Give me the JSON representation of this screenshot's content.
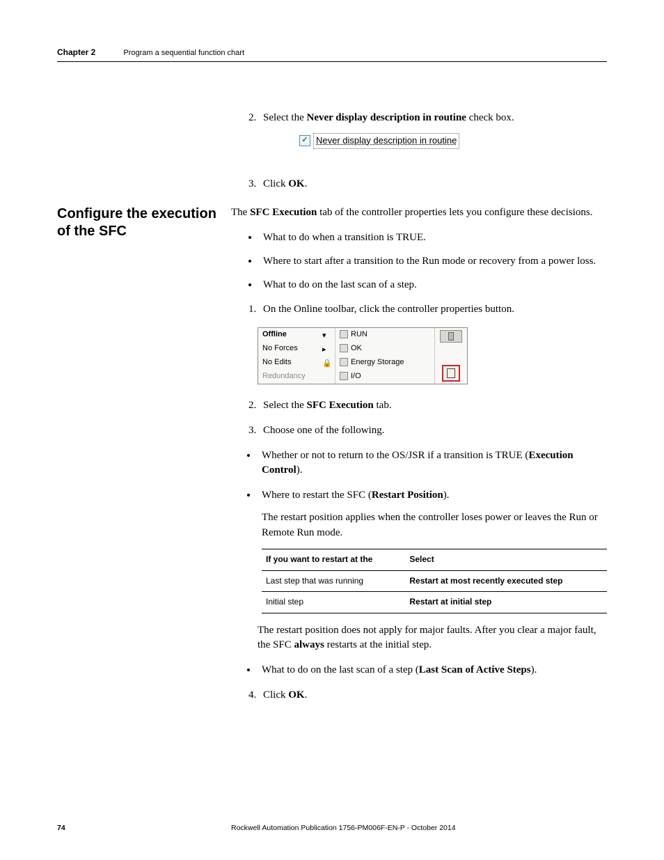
{
  "header": {
    "chapter": "Chapter 2",
    "title": "Program a sequential function chart"
  },
  "step2": {
    "pre": "Select the ",
    "bold": "Never display description in routine",
    "post": " check box."
  },
  "checkbox_label": "Never display description in routine",
  "step3": {
    "pre": "Click ",
    "bold": "OK",
    "post": "."
  },
  "section_heading": "Configure the execution of the SFC",
  "intro": {
    "pre": "The ",
    "bold": "SFC Execution",
    "post": " tab of the controller properties lets you configure these decisions."
  },
  "bullets": {
    "b1": "What to do when a transition is TRUE.",
    "b2": "Where to start after a transition to the Run mode or recovery from a power loss.",
    "b3": "What to do on the last scan of a step."
  },
  "proc": {
    "s1": "On the Online toolbar, click the controller properties button.",
    "s2": {
      "pre": "Select the ",
      "bold": "SFC Execution",
      "post": " tab."
    },
    "s3": "Choose one of the following.",
    "s4": {
      "pre": "Click ",
      "bold": "OK",
      "post": "."
    }
  },
  "toolbar": {
    "offline": "Offline",
    "noforces": "No Forces",
    "noedits": "No Edits",
    "redundancy": "Redundancy",
    "run": "RUN",
    "ok": "OK",
    "energy": "Energy Storage",
    "io": "I/O"
  },
  "sub": {
    "a": {
      "pre": "Whether or not to return to the OS/JSR if a transition is TRUE (",
      "bold": "Execution Control",
      "post": ")."
    },
    "b": {
      "pre": "Where to restart the SFC (",
      "bold": "Restart Position",
      "post": ")."
    },
    "b_note": "The restart position applies when the controller loses power or leaves the Run or Remote Run mode.",
    "c": {
      "pre": "What to do on the last scan of a step (",
      "bold": "Last Scan of Active Steps",
      "post": ")."
    }
  },
  "table": {
    "h1": "If you want to restart at the",
    "h2": "Select",
    "r1c1": "Last step that was running",
    "r1c2": "Restart at most recently executed step",
    "r2c1": "Initial step",
    "r2c2": "Restart at initial step"
  },
  "after_table": {
    "pre": "The restart position does not apply for major faults. After you clear a major fault, the SFC ",
    "bold": "always",
    "post": " restarts at the initial step."
  },
  "footer": {
    "page": "74",
    "pub": "Rockwell Automation Publication 1756-PM006F-EN-P - October 2014"
  }
}
